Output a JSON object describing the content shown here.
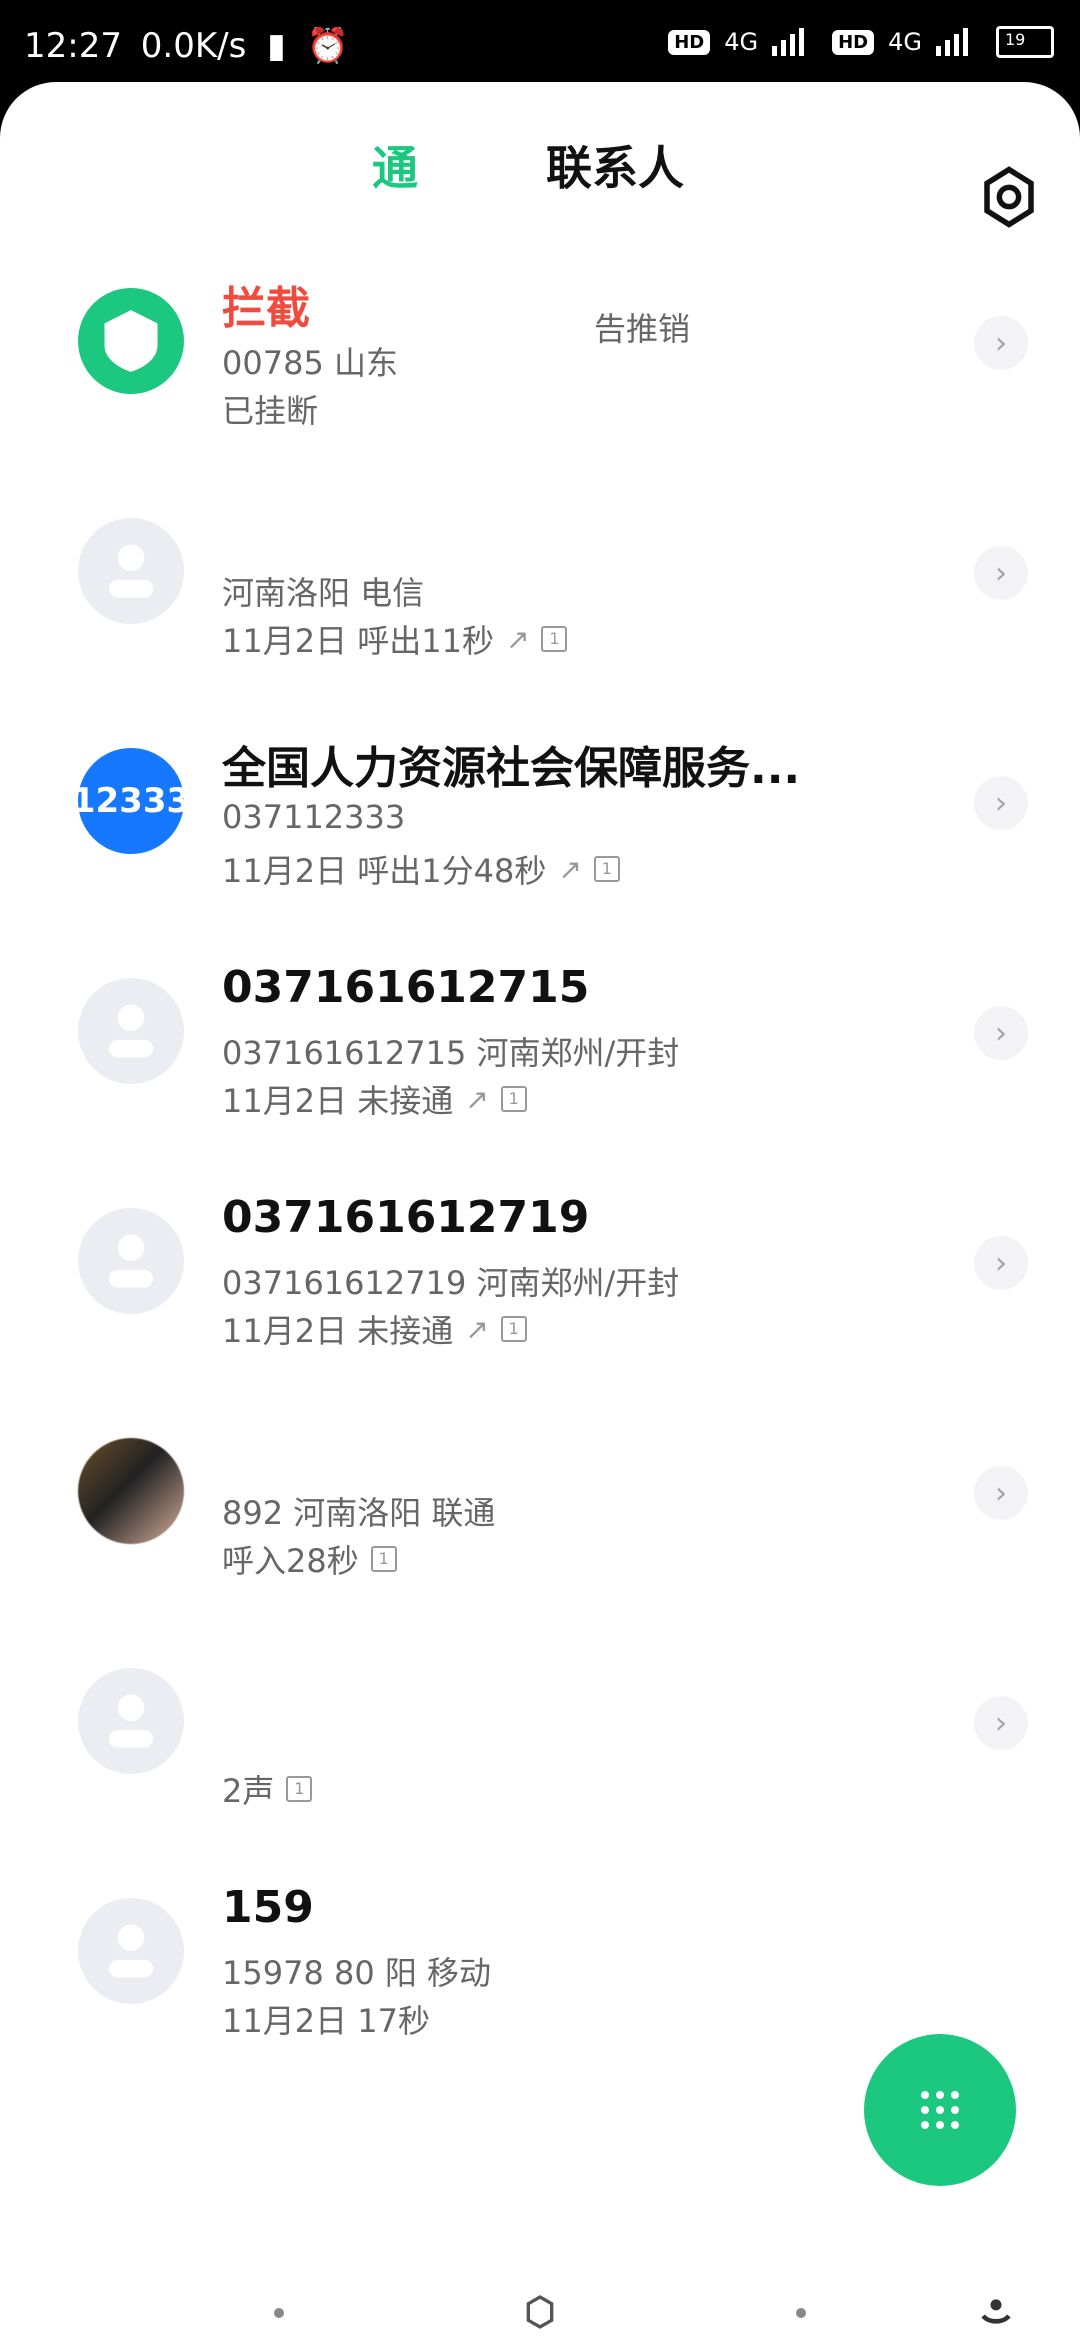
{
  "status_bar": {
    "time": "12:27",
    "speed": "0.0K/s",
    "hd": "HD",
    "network": "4G",
    "battery": "19"
  },
  "header": {
    "tabs": [
      "通",
      "联系人"
    ]
  },
  "calls": [
    {
      "title": "拦截",
      "subtitle": "00785 山东",
      "meta": "已挂断",
      "side_label": "告推销",
      "avatar": "shield-icon"
    },
    {
      "title": "",
      "subtitle": "河南洛阳 电信",
      "meta": "11月2日 呼出11秒",
      "avatar": "person-icon"
    },
    {
      "title": "全国人力资源社会保障服务...",
      "subtitle": "037112333",
      "meta": "11月2日 呼出1分48秒",
      "avatar": "12333"
    },
    {
      "title": "037161612715",
      "subtitle": "037161612715 河南郑州/开封",
      "meta": "11月2日 未接通",
      "avatar": "person-icon"
    },
    {
      "title": "037161612719",
      "subtitle": "037161612719 河南郑州/开封",
      "meta": "11月2日 未接通",
      "avatar": "person-icon"
    },
    {
      "title": "",
      "subtitle": "892 河南洛阳 联通",
      "meta": "呼入28秒",
      "avatar": "photo"
    },
    {
      "title": "",
      "subtitle": "",
      "meta": "2声",
      "avatar": "person-icon"
    },
    {
      "title": "159",
      "subtitle": "15978 80 阳 移动",
      "meta": "11月2日 17秒",
      "avatar": "person-icon"
    }
  ],
  "colors": {
    "accent": "#1cc780",
    "blue_badge": "#1677ff"
  }
}
